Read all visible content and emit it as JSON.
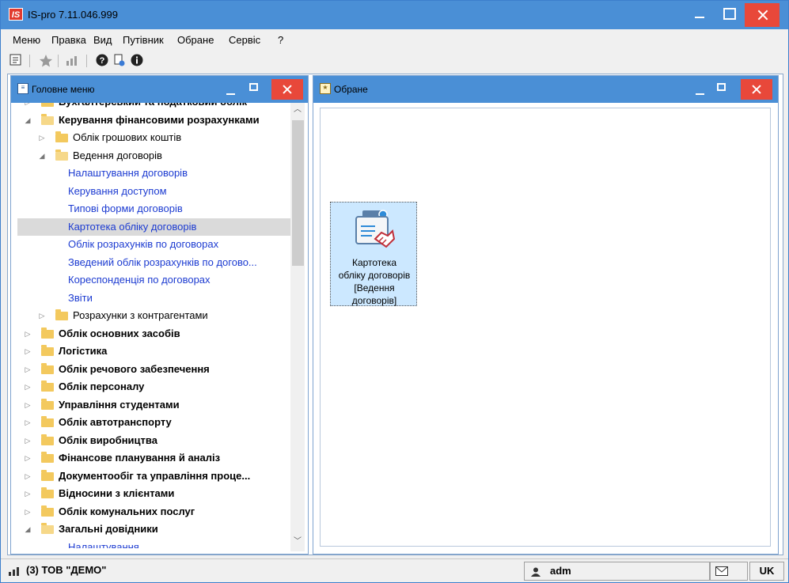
{
  "app": {
    "title": "IS-pro 7.11.046.999",
    "logo_text": "IS"
  },
  "menubar": {
    "items": [
      "Меню",
      "Правка",
      "Вид",
      "Путівник",
      "Обране",
      "Сервіс",
      "?"
    ]
  },
  "toolbar": {
    "icons": [
      "outline-icon",
      "star-icon",
      "chart-icon",
      "help-icon",
      "doc-info-icon",
      "info-icon"
    ]
  },
  "left_panel": {
    "title": "Головне меню",
    "tree": [
      {
        "label": "Бухгалтерський та податковий облік",
        "level": 0,
        "expander": "collapsed",
        "icon": "folder",
        "style": "bold"
      },
      {
        "label": "Керування фінансовими розрахунками",
        "level": 0,
        "expander": "expanded",
        "icon": "folder-open",
        "style": "bold"
      },
      {
        "label": "Облік грошових коштів",
        "level": 1,
        "expander": "collapsed",
        "icon": "folder",
        "style": "normal"
      },
      {
        "label": "Ведення договорів",
        "level": 1,
        "expander": "expanded",
        "icon": "folder-open",
        "style": "normal"
      },
      {
        "label": "Налаштування договорів",
        "level": 2,
        "expander": "none",
        "icon": "none",
        "style": "link"
      },
      {
        "label": "Керування доступом",
        "level": 2,
        "expander": "none",
        "icon": "none",
        "style": "link"
      },
      {
        "label": "Типові форми договорів",
        "level": 2,
        "expander": "none",
        "icon": "none",
        "style": "link"
      },
      {
        "label": "Картотека обліку договорів",
        "level": 2,
        "expander": "none",
        "icon": "none",
        "style": "selected"
      },
      {
        "label": "Облік розрахунків по договорах",
        "level": 2,
        "expander": "none",
        "icon": "none",
        "style": "link"
      },
      {
        "label": "Зведений облік розрахунків по догово...",
        "level": 2,
        "expander": "none",
        "icon": "none",
        "style": "link"
      },
      {
        "label": "Кореспонденція по договорах",
        "level": 2,
        "expander": "none",
        "icon": "none",
        "style": "link"
      },
      {
        "label": "Звіти",
        "level": 2,
        "expander": "none",
        "icon": "none",
        "style": "link"
      },
      {
        "label": "Розрахунки з контрагентами",
        "level": 1,
        "expander": "collapsed",
        "icon": "folder",
        "style": "normal"
      },
      {
        "label": "Облік основних засобів",
        "level": 0,
        "expander": "collapsed",
        "icon": "folder",
        "style": "bold"
      },
      {
        "label": "Логістика",
        "level": 0,
        "expander": "collapsed",
        "icon": "folder",
        "style": "bold"
      },
      {
        "label": "Облік речового забезпечення",
        "level": 0,
        "expander": "collapsed",
        "icon": "folder",
        "style": "bold"
      },
      {
        "label": "Облік персоналу",
        "level": 0,
        "expander": "collapsed",
        "icon": "folder",
        "style": "bold"
      },
      {
        "label": "Управління студентами",
        "level": 0,
        "expander": "collapsed",
        "icon": "folder",
        "style": "bold"
      },
      {
        "label": "Облік автотранспорту",
        "level": 0,
        "expander": "collapsed",
        "icon": "folder",
        "style": "bold"
      },
      {
        "label": "Облік виробництва",
        "level": 0,
        "expander": "collapsed",
        "icon": "folder",
        "style": "bold"
      },
      {
        "label": "Фінансове планування й аналіз",
        "level": 0,
        "expander": "collapsed",
        "icon": "folder",
        "style": "bold"
      },
      {
        "label": "Документообіг та управління проце...",
        "level": 0,
        "expander": "collapsed",
        "icon": "folder",
        "style": "bold"
      },
      {
        "label": "Відносини з клієнтами",
        "level": 0,
        "expander": "collapsed",
        "icon": "folder",
        "style": "bold"
      },
      {
        "label": "Облік комунальних послуг",
        "level": 0,
        "expander": "collapsed",
        "icon": "folder",
        "style": "bold"
      },
      {
        "label": "Загальні довідники",
        "level": 0,
        "expander": "expanded",
        "icon": "folder-open",
        "style": "bold"
      },
      {
        "label": "Налаштування",
        "level": 2,
        "expander": "none",
        "icon": "none",
        "style": "link"
      }
    ]
  },
  "right_panel": {
    "title": "Обране",
    "tile": {
      "icon": "contract-handshake-icon",
      "label_lines": [
        "Картотека",
        "обліку договорів",
        "[Ведення",
        "договорів]"
      ]
    }
  },
  "statusbar": {
    "org": "(3) ТОВ \"ДЕМО\"",
    "user": "adm",
    "lang": "UK"
  },
  "colors": {
    "title_bar": "#4a8fd6",
    "close_button": "#e8483a",
    "link_text": "#1c3bd1",
    "selected_row": "#dadada",
    "tile_selected": "#cce8ff",
    "folder": "#f3c95e"
  }
}
